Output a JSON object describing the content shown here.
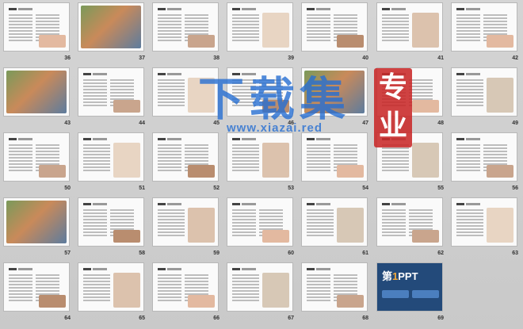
{
  "slides": [
    {
      "n": "36"
    },
    {
      "n": "37"
    },
    {
      "n": "38"
    },
    {
      "n": "39"
    },
    {
      "n": "40"
    },
    {
      "n": "41"
    },
    {
      "n": "42"
    },
    {
      "n": "43"
    },
    {
      "n": "44"
    },
    {
      "n": "45"
    },
    {
      "n": "46"
    },
    {
      "n": "47"
    },
    {
      "n": "48"
    },
    {
      "n": "49"
    },
    {
      "n": "50"
    },
    {
      "n": "51"
    },
    {
      "n": "52"
    },
    {
      "n": "53"
    },
    {
      "n": "54"
    },
    {
      "n": "55"
    },
    {
      "n": "56"
    },
    {
      "n": "57"
    },
    {
      "n": "58"
    },
    {
      "n": "59"
    },
    {
      "n": "60"
    },
    {
      "n": "61"
    },
    {
      "n": "62"
    },
    {
      "n": "63"
    },
    {
      "n": "64"
    },
    {
      "n": "65"
    },
    {
      "n": "66"
    },
    {
      "n": "67"
    },
    {
      "n": "68"
    },
    {
      "n": "69"
    }
  ],
  "watermark": {
    "text": "下载集",
    "url": "www.xiazai.red",
    "seal": "专业"
  },
  "ppt_logo": {
    "prefix": "第",
    "digit": "1",
    "suffix": "PPT"
  },
  "colors": {
    "background": "#cccccc",
    "watermark": "#266ed2",
    "seal": "#c82828",
    "ppt_slide": "#234a7a"
  }
}
